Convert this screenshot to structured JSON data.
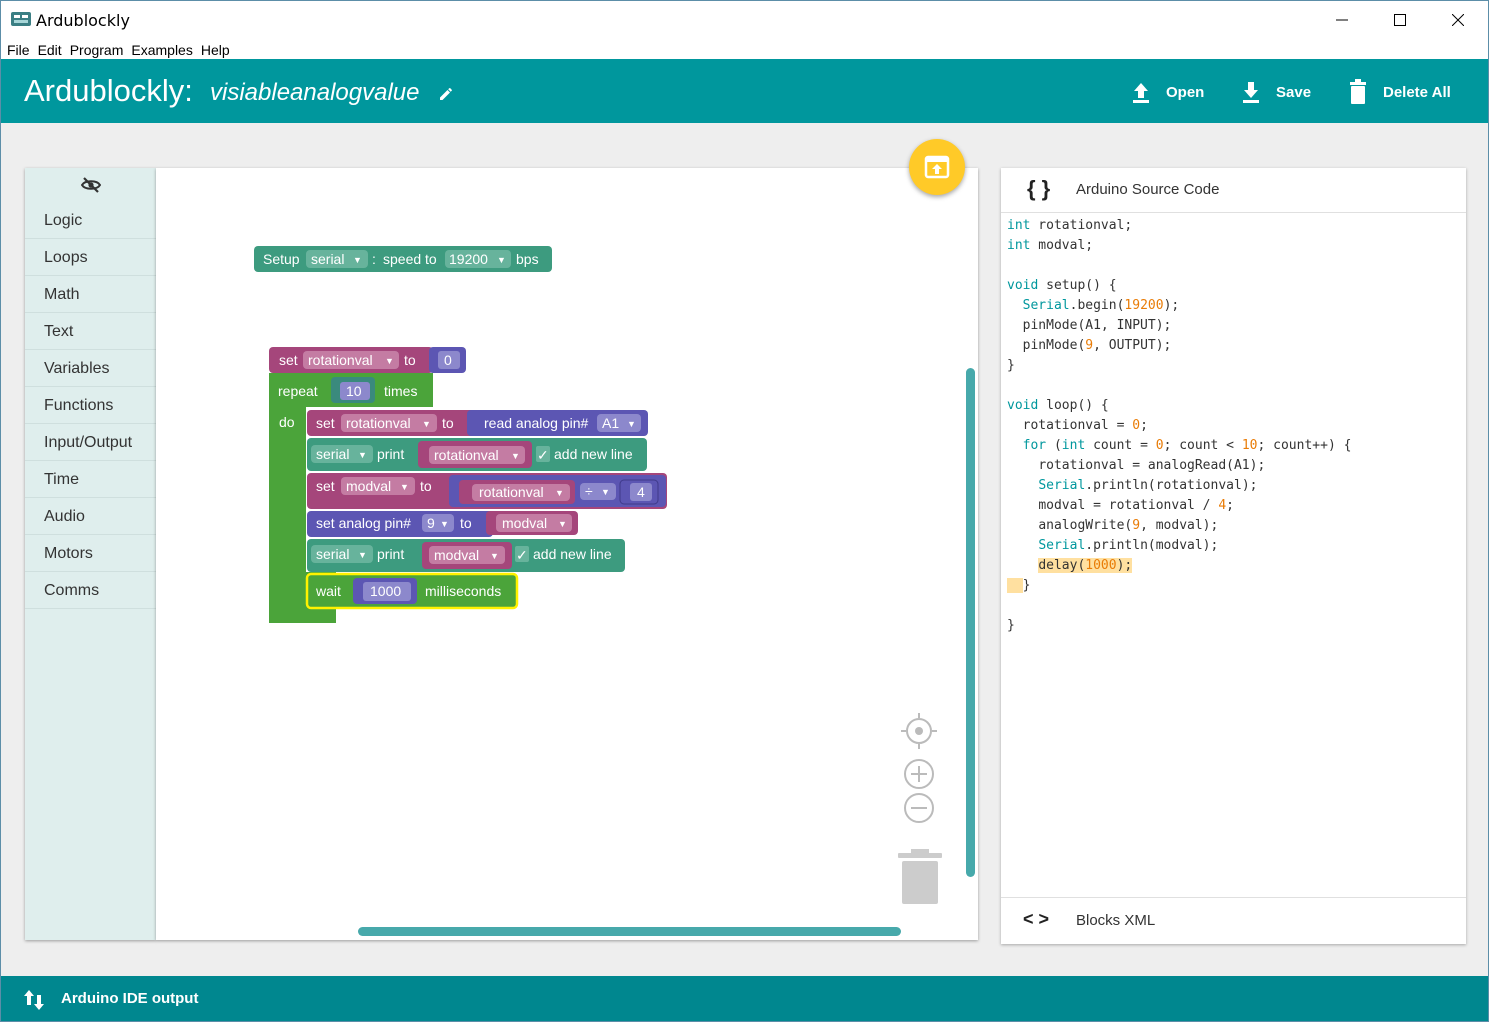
{
  "window": {
    "title": "Ardublockly"
  },
  "menu": [
    "File",
    "Edit",
    "Program",
    "Examples",
    "Help"
  ],
  "header": {
    "brand": "Ardublockly:",
    "sketch_name": "visiableanalogvalue",
    "open_label": "Open",
    "save_label": "Save",
    "delete_label": "Delete All"
  },
  "toolbox": [
    "Logic",
    "Loops",
    "Math",
    "Text",
    "Variables",
    "Functions",
    "Input/Output",
    "Time",
    "Audio",
    "Motors",
    "Comms"
  ],
  "blocks": {
    "setup": {
      "label": "Setup",
      "port": "serial",
      "colon": ":",
      "speed_label": "speed to",
      "speed": "19200",
      "unit": "bps"
    },
    "set1": {
      "label": "set",
      "var": "rotationval",
      "to": "to",
      "value": "0"
    },
    "repeat": {
      "label": "repeat",
      "times_value": "10",
      "times": "times",
      "do": "do"
    },
    "set2": {
      "label": "set",
      "var": "rotationval",
      "to": "to",
      "read_label": "read analog pin#",
      "pin": "A1"
    },
    "print1": {
      "port": "serial",
      "label": "print",
      "var": "rotationval",
      "check": "✓",
      "newline": "add new line"
    },
    "set3": {
      "label": "set",
      "var": "modval",
      "to": "to",
      "operand": "rotationval",
      "op": "÷",
      "divisor": "4"
    },
    "analog": {
      "label": "set analog pin#",
      "pin": "9",
      "to": "to",
      "var": "modval"
    },
    "print2": {
      "port": "serial",
      "label": "print",
      "var": "modval",
      "check": "✓",
      "newline": "add new line"
    },
    "wait": {
      "label": "wait",
      "value": "1000",
      "unit": "milliseconds"
    }
  },
  "code_panel": {
    "title_icon": "{ }",
    "title": "Arduino Source Code",
    "footer_icon": "< >",
    "footer": "Blocks XML"
  },
  "code": {
    "l1_kw": "int",
    "l1": " rotationval;",
    "l2_kw": "int",
    "l2": " modval;",
    "l4_kw": "void",
    "l4": " setup() {",
    "l5_obj": "Serial",
    "l5a": ".begin(",
    "l5_num": "19200",
    "l5b": ");",
    "l6": "pinMode(A1, INPUT);",
    "l7a": "pinMode(",
    "l7_num": "9",
    "l7b": ", OUTPUT);",
    "l8": "}",
    "l10_kw": "void",
    "l10": " loop() {",
    "l11a": "rotationval = ",
    "l11_num": "0",
    "l11b": ";",
    "l12_kw": "for",
    "l12a": " (",
    "l12_kw2": "int",
    "l12b": " count = ",
    "l12_n1": "0",
    "l12c": "; count < ",
    "l12_n2": "10",
    "l12d": "; count++) {",
    "l13": "rotationval = analogRead(A1);",
    "l14_obj": "Serial",
    "l14": ".println(rotationval);",
    "l15a": "modval = rotationval / ",
    "l15_num": "4",
    "l15b": ";",
    "l16a": "analogWrite(",
    "l16_num": "9",
    "l16b": ", modval);",
    "l17_obj": "Serial",
    "l17": ".println(modval);",
    "l18a": "delay(",
    "l18_num": "1000",
    "l18b": ");",
    "l19": "}",
    "l21": "}"
  },
  "footer": {
    "label": "Arduino IDE output"
  },
  "colors": {
    "teal": "#00979d",
    "variable": "#a5467b",
    "loops": "#4ba43a",
    "serial": "#3d9b7f",
    "io": "#5c56b3",
    "accent": "#ffca28"
  }
}
